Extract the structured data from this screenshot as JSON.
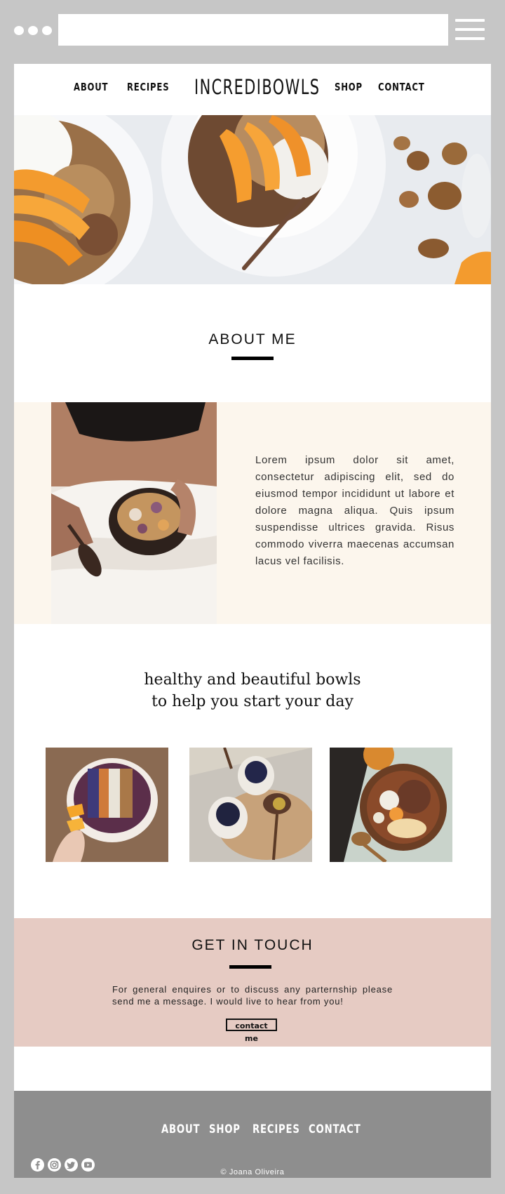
{
  "nav": {
    "about": "ABOUT",
    "recipes": "RECIPES",
    "brand": "INCREDIBOWLS",
    "shop": "SHOP",
    "contact": "CONTACT"
  },
  "about": {
    "title": "ABOUT ME",
    "text": "Lorem ipsum dolor sit amet, consectetur adipiscing elit, sed do eiusmod tempor incididunt ut labore et dolore magna aliqua. Quis ipsum suspendisse ultrices gravida. Risus commodo viverra maecenas accumsan lacus vel facilisis."
  },
  "tagline": {
    "line1": "healthy and beautiful bowls",
    "line2": "to help you start your day"
  },
  "contact": {
    "title": "GET IN TOUCH",
    "text": "For general enquires or to discuss any parternship please send me a message. I would live to hear from you!",
    "button": "contact me"
  },
  "footer": {
    "nav": [
      "ABOUT",
      "SHOP",
      "RECIPES",
      "CONTACT"
    ],
    "social": [
      "facebook-icon",
      "instagram-icon",
      "twitter-icon",
      "youtube-icon"
    ],
    "copyright": "© Joana Oliveira"
  },
  "colors": {
    "chrome": "#c6c6c6",
    "about_band": "#fcf6ed",
    "contact_band": "#e6cbc3",
    "footer": "#8e8e8e"
  }
}
